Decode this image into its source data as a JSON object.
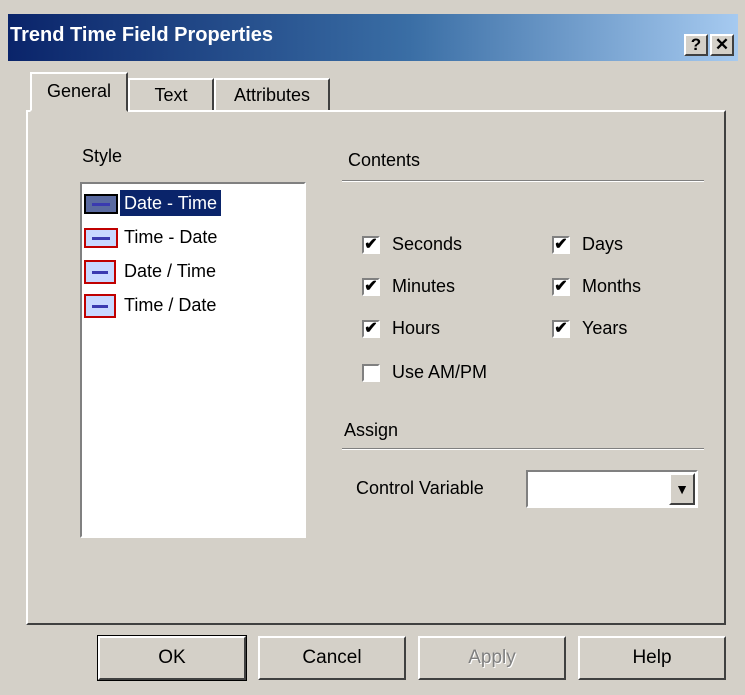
{
  "window": {
    "title": "Trend Time Field Properties",
    "help_label": "?",
    "close_label": "✕"
  },
  "tabs": [
    {
      "label": "General",
      "active": true
    },
    {
      "label": "Text",
      "active": false
    },
    {
      "label": "Attributes",
      "active": false
    }
  ],
  "style": {
    "heading": "Style",
    "items": [
      {
        "label": "Date - Time",
        "selected": true
      },
      {
        "label": "Time - Date",
        "selected": false
      },
      {
        "label": "Date / Time",
        "selected": false
      },
      {
        "label": "Time / Date",
        "selected": false
      }
    ]
  },
  "contents": {
    "heading": "Contents",
    "checkboxes": [
      {
        "label": "Seconds",
        "checked": true
      },
      {
        "label": "Minutes",
        "checked": true
      },
      {
        "label": "Hours",
        "checked": true
      },
      {
        "label": "Use AM/PM",
        "checked": false
      },
      {
        "label": "Days",
        "checked": true
      },
      {
        "label": "Months",
        "checked": true
      },
      {
        "label": "Years",
        "checked": true
      }
    ]
  },
  "assign": {
    "heading": "Assign",
    "control_variable_label": "Control Variable",
    "control_variable_value": "",
    "dropdown_glyph": "▼"
  },
  "buttons": {
    "ok": "OK",
    "cancel": "Cancel",
    "apply": "Apply",
    "help": "Help"
  },
  "check_glyph": "✔",
  "colors": {
    "face": "#d4d0c8",
    "title_start": "#0a246a",
    "title_end": "#a6caf0",
    "selection": "#0a246a"
  }
}
